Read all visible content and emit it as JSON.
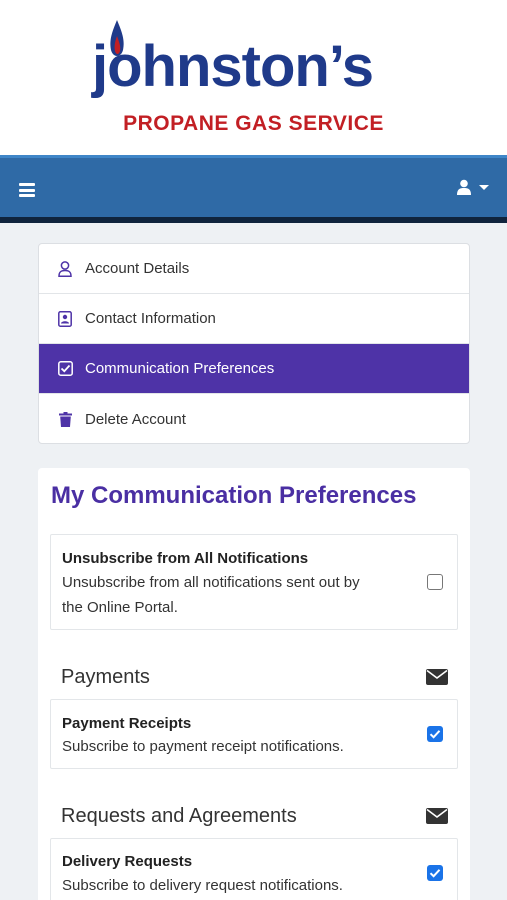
{
  "brand": {
    "name": "johnston’s",
    "tagline": "PROPANE GAS SERVICE",
    "colors": {
      "navy": "#1f3a8a",
      "red": "#c21f24",
      "navbar": "#2f6aa6",
      "accent": "#4e33a7"
    }
  },
  "navbar": {
    "menu_icon": "hamburger-icon",
    "user_icon": "user-icon"
  },
  "account_menu": {
    "items": [
      {
        "label": "Account Details",
        "icon": "user-outline-icon",
        "active": false
      },
      {
        "label": "Contact Information",
        "icon": "contact-card-icon",
        "active": false
      },
      {
        "label": "Communication Preferences",
        "icon": "check-square-icon",
        "active": true
      },
      {
        "label": "Delete Account",
        "icon": "trash-icon",
        "active": false
      }
    ]
  },
  "preferences": {
    "title": "My Communication Preferences",
    "unsubscribe_all": {
      "title": "Unsubscribe from All Notifications",
      "description_line1": "Unsubscribe from all notifications sent out by",
      "description_line2": "the Online Portal.",
      "checked": false
    },
    "sections": [
      {
        "heading": "Payments",
        "icon": "envelope-icon",
        "items": [
          {
            "title": "Payment Receipts",
            "description": "Subscribe to payment receipt notifications.",
            "checked": true
          }
        ]
      },
      {
        "heading": "Requests and Agreements",
        "icon": "envelope-icon",
        "items": [
          {
            "title": "Delivery Requests",
            "description": "Subscribe to delivery request notifications.",
            "checked": true
          }
        ]
      }
    ]
  }
}
